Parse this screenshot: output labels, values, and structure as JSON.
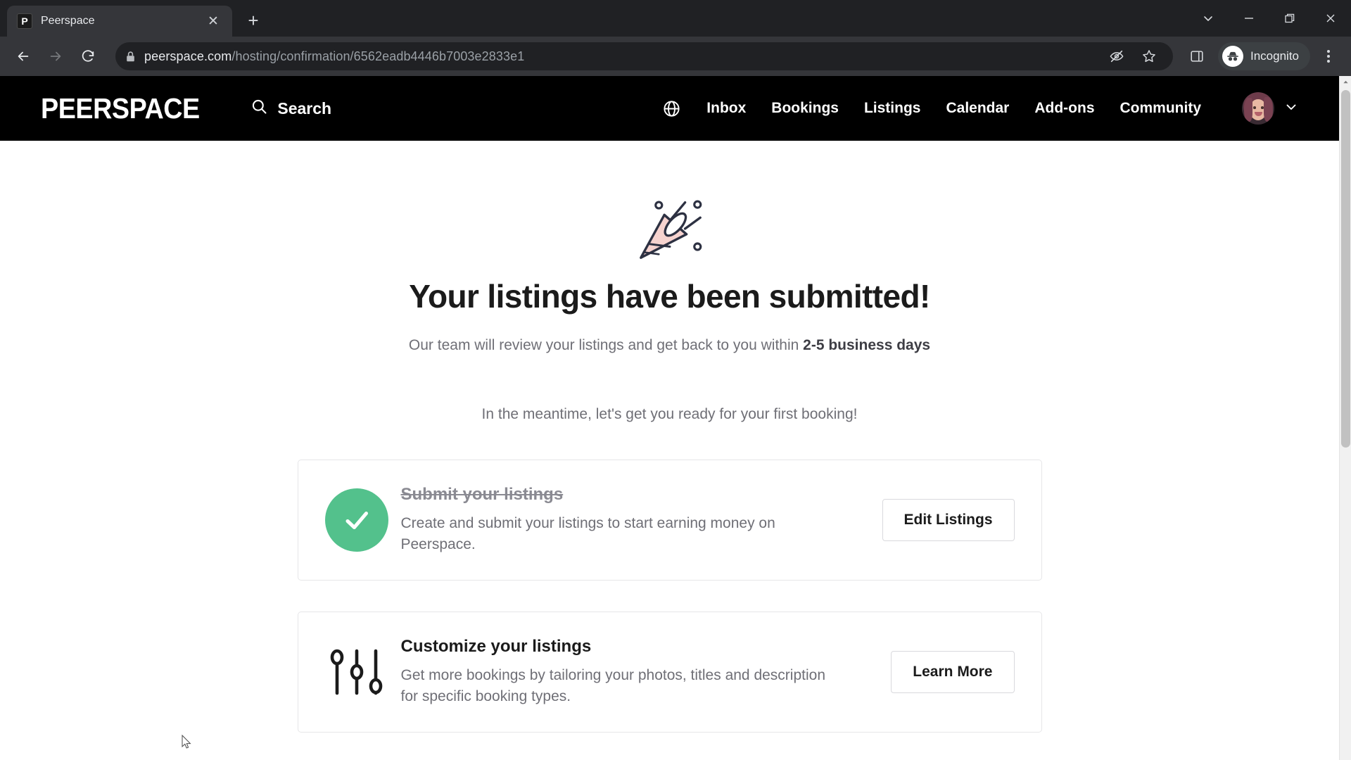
{
  "browser": {
    "tab": {
      "title": "Peerspace",
      "favicon_letter": "P",
      "favicon_name": "peerspace-favicon",
      "close_label": "✕"
    },
    "new_tab_label": "+",
    "window_controls": {
      "tab_search": "tab-search-icon",
      "minimize": "minimize-icon",
      "maximize": "restore-icon",
      "close": "close-icon"
    },
    "toolbar": {
      "back": "back-arrow-icon",
      "forward": "forward-arrow-icon",
      "reload": "reload-icon",
      "lock": "lock-icon",
      "url_host": "peerspace.com",
      "url_path": "/hosting/confirmation/6562eadb4446b7003e2833e1",
      "url_full": "peerspace.com/hosting/confirmation/6562eadb4446b7003e2833e1",
      "tracking_protection": "eye-off-icon",
      "bookmark": "star-icon",
      "side_panel": "side-panel-icon",
      "incognito_label": "Incognito",
      "menu": "kebab-menu-icon"
    }
  },
  "site": {
    "logo": "PEERSPACE",
    "search_label": "Search",
    "language_icon": "globe-icon",
    "nav": [
      {
        "label": "Inbox"
      },
      {
        "label": "Bookings"
      },
      {
        "label": "Listings"
      },
      {
        "label": "Calendar"
      },
      {
        "label": "Add-ons"
      },
      {
        "label": "Community"
      }
    ],
    "account": {
      "avatar_alt": "user-avatar",
      "chevron": "chevron-down-icon"
    }
  },
  "main": {
    "celebration_icon": "party-popper-icon",
    "headline": "Your listings have been submitted!",
    "subline_prefix": "Our team will review your listings and get back to you within ",
    "subline_bold": "2-5 business days",
    "meantime": "In the meantime, let's get you ready for your first booking!",
    "cards": [
      {
        "icon": "green-check-circle-icon",
        "title": "Submit your listings",
        "completed": true,
        "description": "Create and submit your listings to start earning money on Peerspace.",
        "button": "Edit Listings"
      },
      {
        "icon": "sliders-icon",
        "title": "Customize your listings",
        "completed": false,
        "description": "Get more bookings by tailoring your photos, titles and description for specific booking types.",
        "button": "Learn More"
      }
    ]
  },
  "colors": {
    "brand_black": "#000000",
    "success_green": "#53c18c",
    "text_primary": "#1b1b1b",
    "text_muted": "#6f6f76",
    "card_border": "#e6e6e8"
  }
}
